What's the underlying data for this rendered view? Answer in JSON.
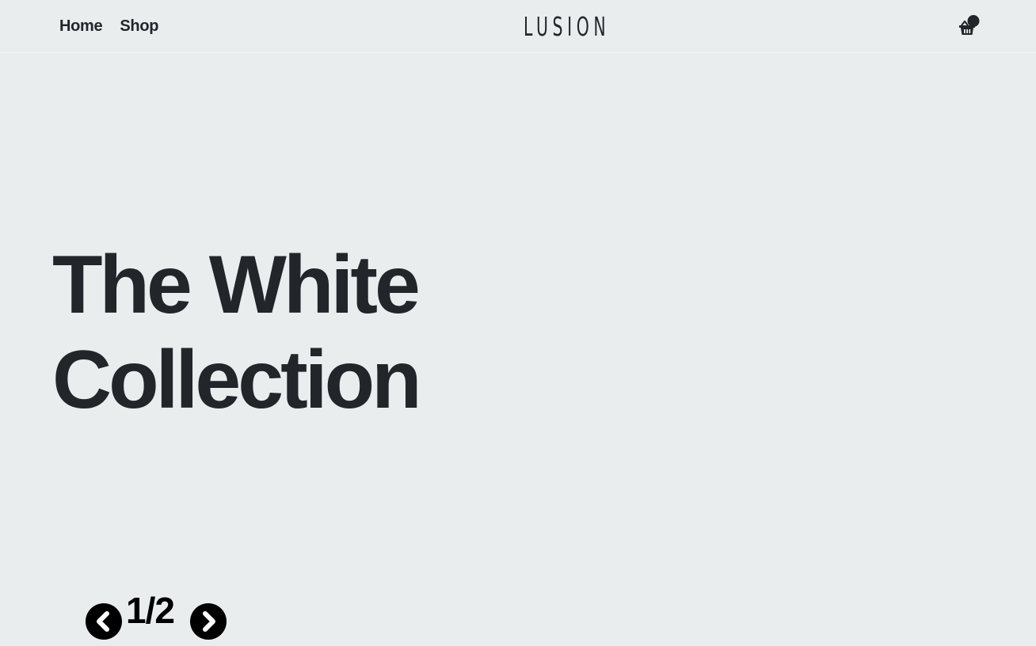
{
  "header": {
    "nav": [
      {
        "label": "Home"
      },
      {
        "label": "Shop"
      }
    ],
    "logo": "LUSION",
    "cart_icon": "shopping-basket-icon"
  },
  "hero": {
    "title_line1": "The White",
    "title_line2": "Collection"
  },
  "slider": {
    "prev_icon": "chevron-left-icon",
    "next_icon": "chevron-right-icon",
    "counter": "1/2",
    "current_slide": 1,
    "total_slides": 2
  },
  "colors": {
    "background": "#e9edee",
    "text": "#22262b",
    "controls": "#000000"
  }
}
